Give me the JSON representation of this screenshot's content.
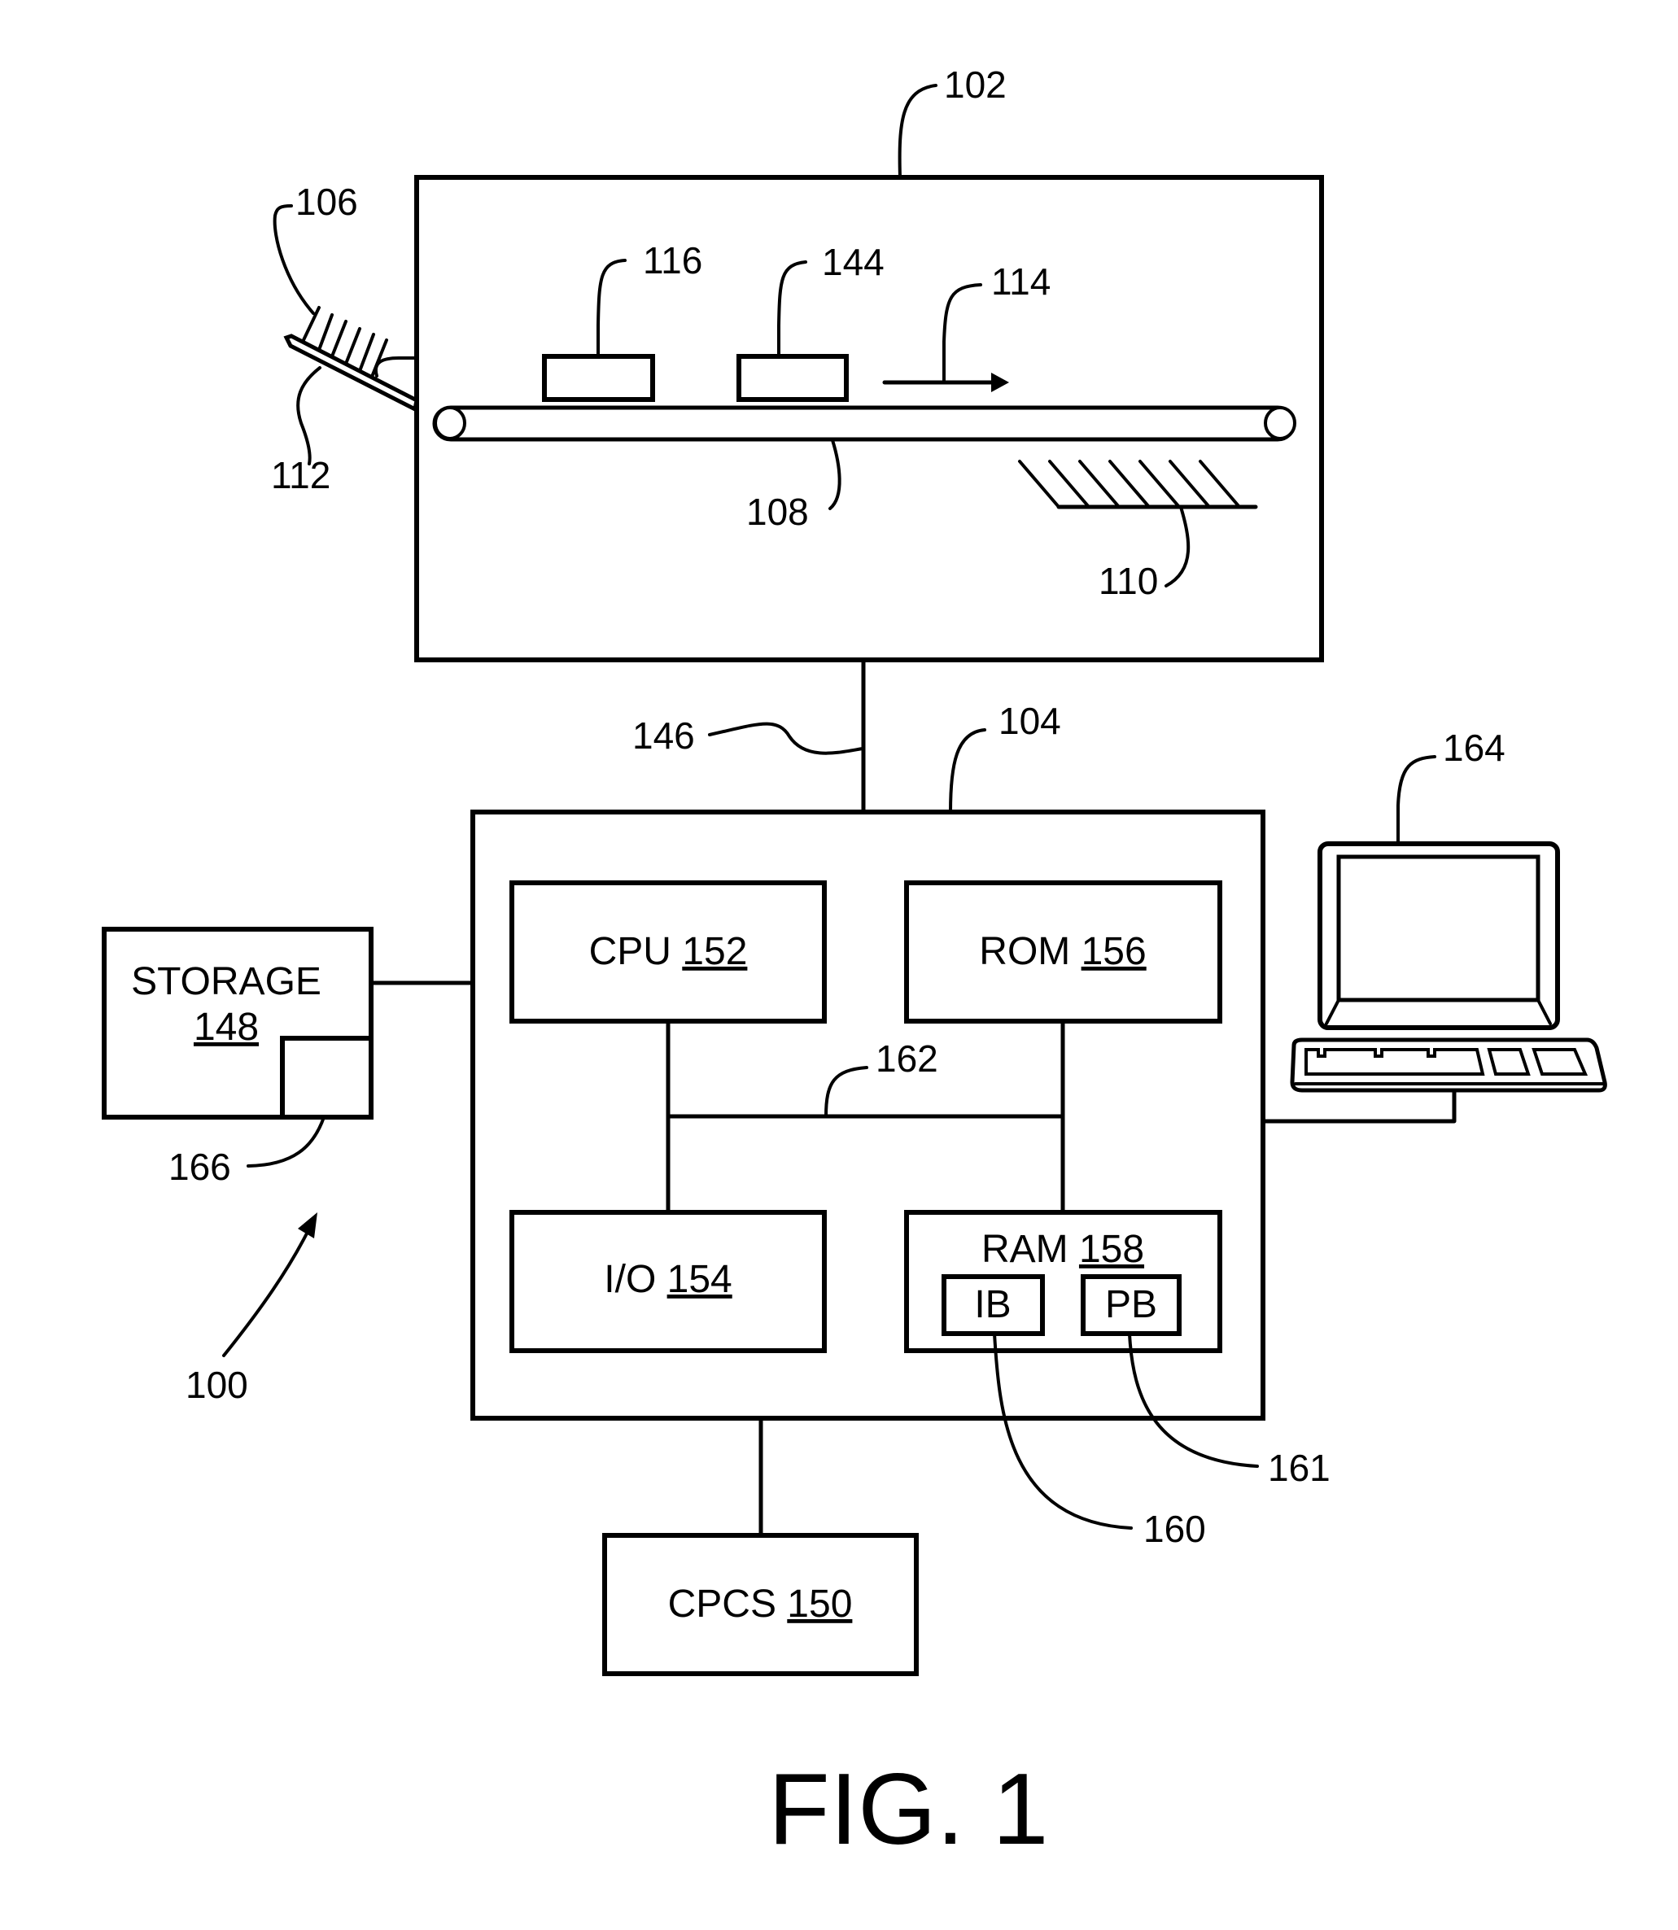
{
  "figure": {
    "caption": "FIG. 1",
    "system_ref": "100"
  },
  "printer": {
    "ref": "102",
    "input_tray_ref": "106",
    "tray_ref": "112",
    "belt_ref": "108",
    "output_tray_ref": "110",
    "direction_ref": "114",
    "module_a_ref": "116",
    "module_b_ref": "144",
    "link_ref": "146"
  },
  "controller": {
    "ref": "104",
    "bus_ref": "162",
    "cpu": {
      "name": "CPU",
      "ref": "152"
    },
    "rom": {
      "name": "ROM",
      "ref": "156"
    },
    "io": {
      "name": "I/O",
      "ref": "154"
    },
    "ram": {
      "name": "RAM",
      "ref": "158"
    },
    "ib": {
      "name": "IB",
      "ref": "160"
    },
    "pb": {
      "name": "PB",
      "ref": "161"
    }
  },
  "storage": {
    "name": "STORAGE",
    "ref": "148",
    "sub_ref": "166"
  },
  "cpcs": {
    "name": "CPCS",
    "ref": "150"
  },
  "terminal": {
    "ref": "164"
  }
}
